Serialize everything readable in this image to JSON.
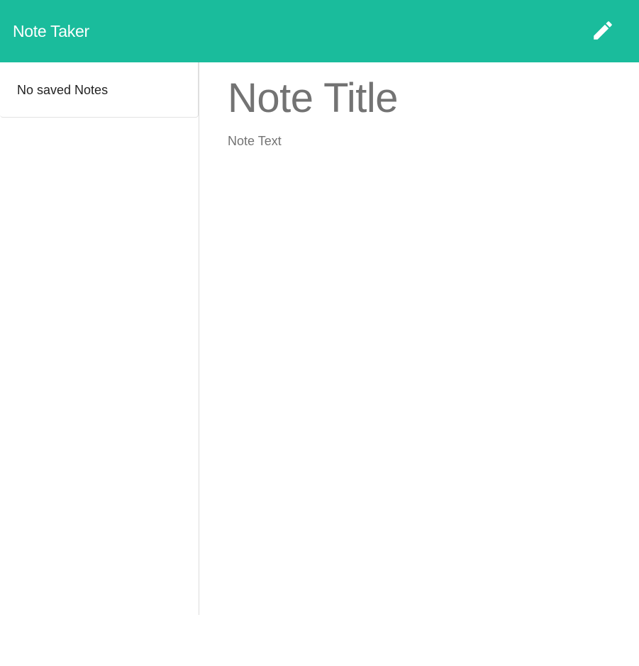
{
  "navbar": {
    "brand": "Note Taker",
    "new_note_icon": "pencil-icon"
  },
  "sidebar": {
    "items": [
      {
        "label": "No saved Notes"
      }
    ]
  },
  "editor": {
    "title_placeholder": "Note Title",
    "text_placeholder": "Note Text"
  },
  "colors": {
    "accent": "#1abc9c",
    "placeholder_text": "#737373"
  }
}
